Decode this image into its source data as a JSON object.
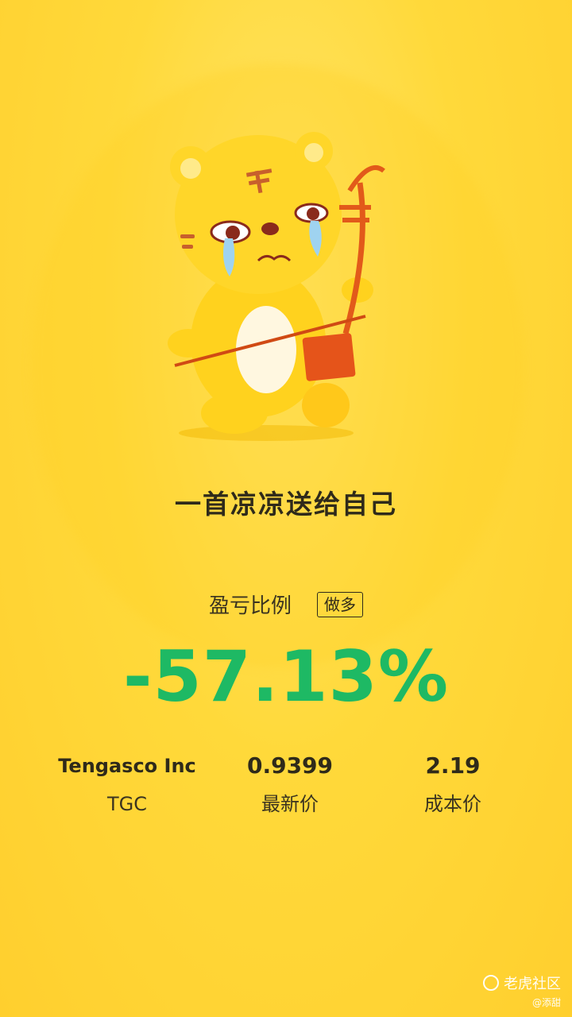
{
  "card": {
    "title": "一首凉凉送给自己",
    "ratio_label": "盈亏比例",
    "position_badge": "做多",
    "pnl_percent": "-57.13%",
    "pnl_color": "#1eb964",
    "stock_name": "Tengasco Inc",
    "ticker": "TGC",
    "last_price": "0.9399",
    "last_price_label": "最新价",
    "cost_price": "2.19",
    "cost_price_label": "成本价"
  },
  "watermark": {
    "brand": "老虎社区",
    "user": "@添甜",
    "icon": "tiger-logo-icon"
  },
  "mascot": {
    "icon": "crying-tiger-erhu-illustration"
  }
}
